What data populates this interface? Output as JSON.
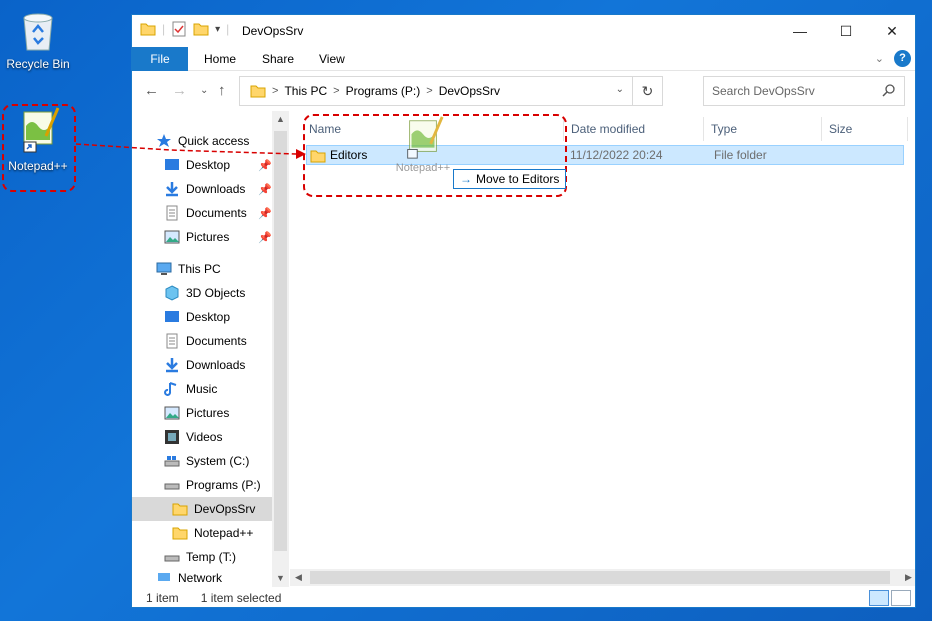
{
  "desktop": {
    "recycle_bin_label": "Recycle Bin",
    "notepad_label": "Notepad++"
  },
  "window": {
    "title": "DevOpsSrv",
    "controls": {
      "minimize": "—",
      "maximize": "☐",
      "close": "✕"
    }
  },
  "ribbon": {
    "tabs": [
      "File",
      "Home",
      "Share",
      "View"
    ],
    "help": "?"
  },
  "address": {
    "crumbs": [
      "This PC",
      "Programs (P:)",
      "DevOpsSrv"
    ],
    "separator": ">"
  },
  "search": {
    "placeholder": "Search DevOpsSrv"
  },
  "navpane": {
    "quick_access": "Quick access",
    "quick_items": [
      "Desktop",
      "Downloads",
      "Documents",
      "Pictures"
    ],
    "this_pc": "This PC",
    "pc_items": [
      "3D Objects",
      "Desktop",
      "Documents",
      "Downloads",
      "Music",
      "Pictures",
      "Videos",
      "System (C:)",
      "Programs (P:)"
    ],
    "sub_items": [
      "DevOpsSrv",
      "Notepad++"
    ],
    "temp": "Temp (T:)",
    "partial": "Network"
  },
  "columns": [
    "Name",
    "Date modified",
    "Type",
    "Size"
  ],
  "files": [
    {
      "name": "Editors",
      "date": "11/12/2022 20:24",
      "type": "File folder",
      "size": ""
    }
  ],
  "drag": {
    "ghost_label": "Notepad++",
    "tooltip": "Move to Editors"
  },
  "status": {
    "count": "1 item",
    "selected": "1 item selected"
  },
  "colors": {
    "accent": "#1979ca",
    "selection": "#cce8ff",
    "annotation": "#d80000"
  }
}
